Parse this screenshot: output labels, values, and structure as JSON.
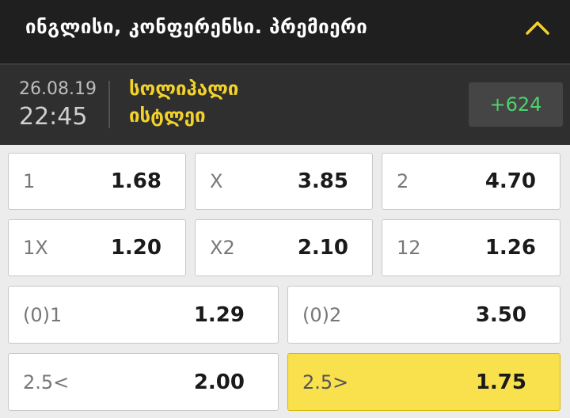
{
  "header": {
    "league_title": "ინგლისი, კონფერენსი. პრემიერი",
    "collapse_icon": "chevron-up-icon"
  },
  "match": {
    "date": "26.08.19",
    "time": "22:45",
    "home_team": "სოლიჰალი",
    "away_team": "ისტლეი",
    "more_markets": "+624"
  },
  "odds": {
    "row1": [
      {
        "label": "1",
        "value": "1.68"
      },
      {
        "label": "X",
        "value": "3.85"
      },
      {
        "label": "2",
        "value": "4.70"
      }
    ],
    "row2": [
      {
        "label": "1X",
        "value": "1.20"
      },
      {
        "label": "X2",
        "value": "2.10"
      },
      {
        "label": "12",
        "value": "1.26"
      }
    ],
    "row3": [
      {
        "label": "(0)1",
        "value": "1.29"
      },
      {
        "label": "(0)2",
        "value": "3.50"
      }
    ],
    "row4": [
      {
        "label": "2.5<",
        "value": "2.00"
      },
      {
        "label": "2.5>",
        "value": "1.75",
        "selected": true
      }
    ]
  },
  "colors": {
    "header_bg": "#1f1f1f",
    "match_bg": "#2f2f2f",
    "team_yellow": "#f3d22b",
    "markets_green": "#4cd36b",
    "selected_bg": "#f9e04d"
  }
}
